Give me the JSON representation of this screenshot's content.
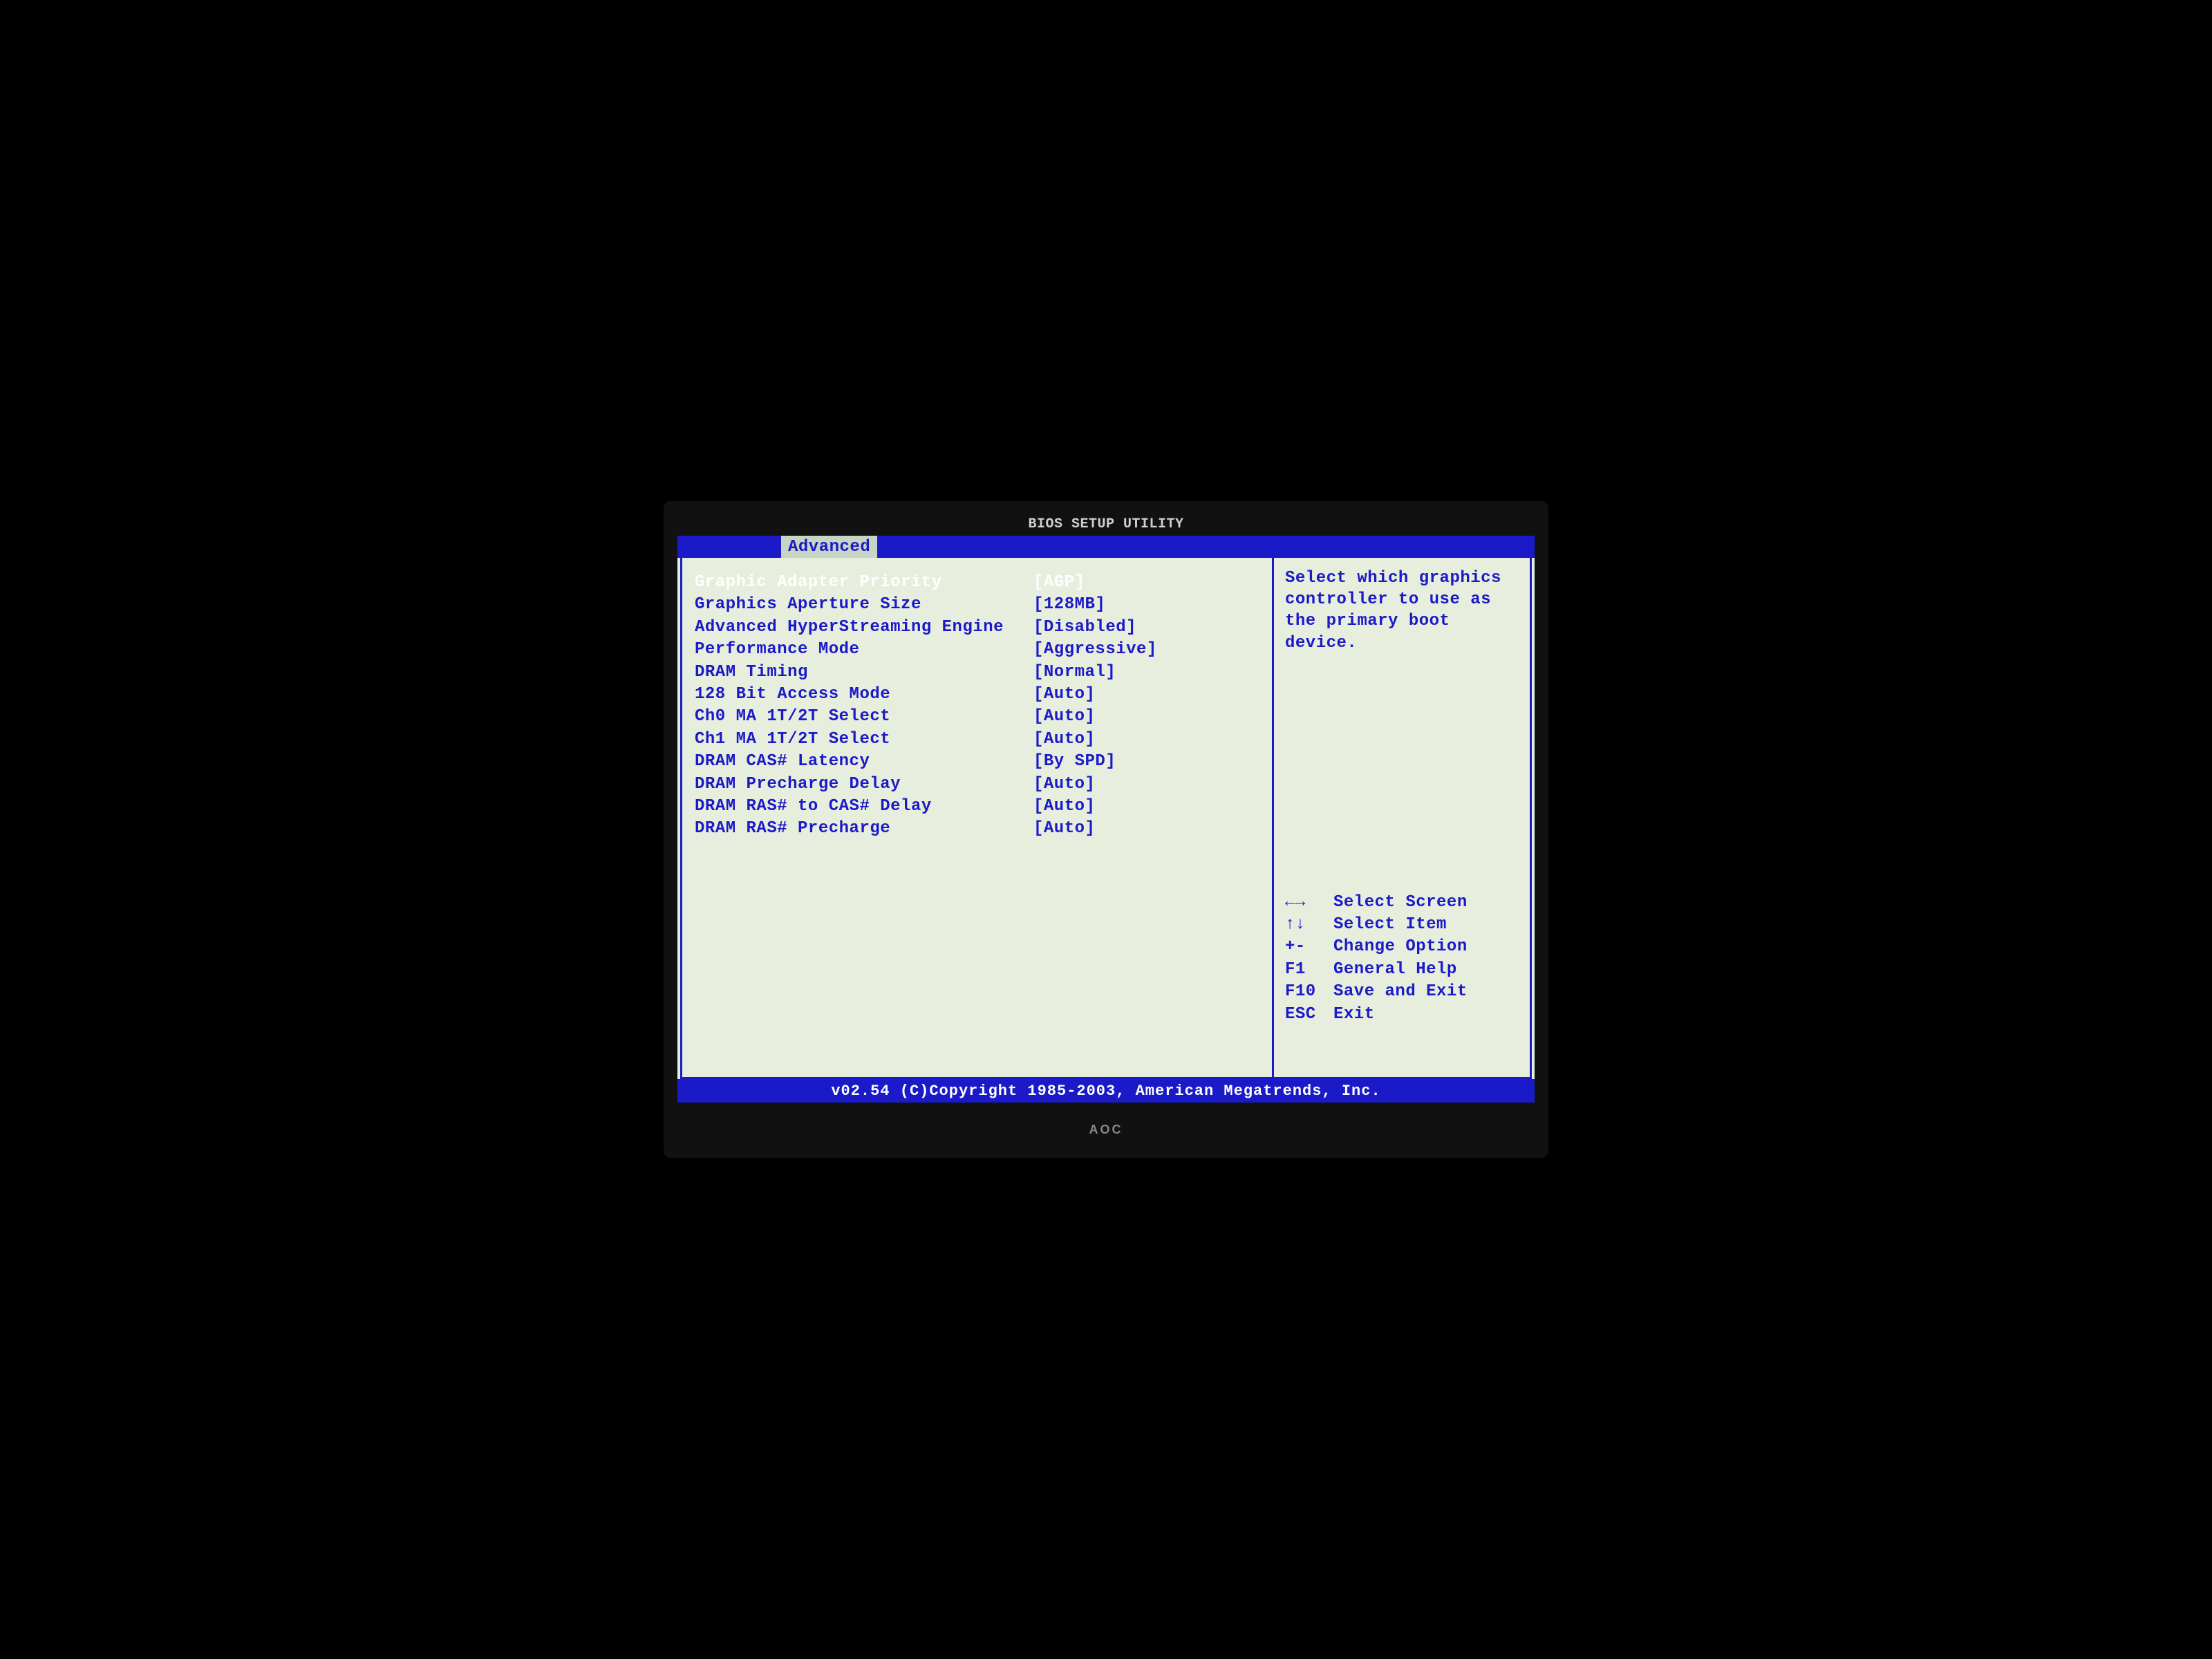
{
  "app_title": "BIOS SETUP UTILITY",
  "active_tab": "Advanced",
  "settings": [
    {
      "label": "Graphic Adapter Priority",
      "value": "[AGP]",
      "selected": true
    },
    {
      "label": "Graphics Aperture Size",
      "value": "[128MB]",
      "selected": false
    },
    {
      "label": "Advanced HyperStreaming Engine",
      "value": "[Disabled]",
      "selected": false
    },
    {
      "label": "Performance Mode",
      "value": "[Aggressive]",
      "selected": false
    },
    {
      "label": "DRAM Timing",
      "value": "[Normal]",
      "selected": false
    },
    {
      "label": "128 Bit Access Mode",
      "value": "[Auto]",
      "selected": false
    },
    {
      "label": "Ch0 MA 1T/2T Select",
      "value": "[Auto]",
      "selected": false
    },
    {
      "label": "Ch1 MA 1T/2T Select",
      "value": "[Auto]",
      "selected": false
    },
    {
      "label": "DRAM CAS# Latency",
      "value": "[By SPD]",
      "selected": false
    },
    {
      "label": "DRAM Precharge Delay",
      "value": "[Auto]",
      "selected": false
    },
    {
      "label": "DRAM RAS# to CAS# Delay",
      "value": "[Auto]",
      "selected": false
    },
    {
      "label": "DRAM RAS# Precharge",
      "value": "[Auto]",
      "selected": false
    }
  ],
  "help": {
    "text": "Select which graphics controller to use as the primary boot device."
  },
  "hints": [
    {
      "key": "←→",
      "action": "Select Screen"
    },
    {
      "key": "↑↓",
      "action": "Select Item"
    },
    {
      "key": "+-",
      "action": "Change Option"
    },
    {
      "key": "F1",
      "action": "General Help"
    },
    {
      "key": "F10",
      "action": "Save and Exit"
    },
    {
      "key": "ESC",
      "action": "Exit"
    }
  ],
  "footer": "v02.54 (C)Copyright 1985-2003, American Megatrends, Inc.",
  "monitor_brand": "AOC"
}
